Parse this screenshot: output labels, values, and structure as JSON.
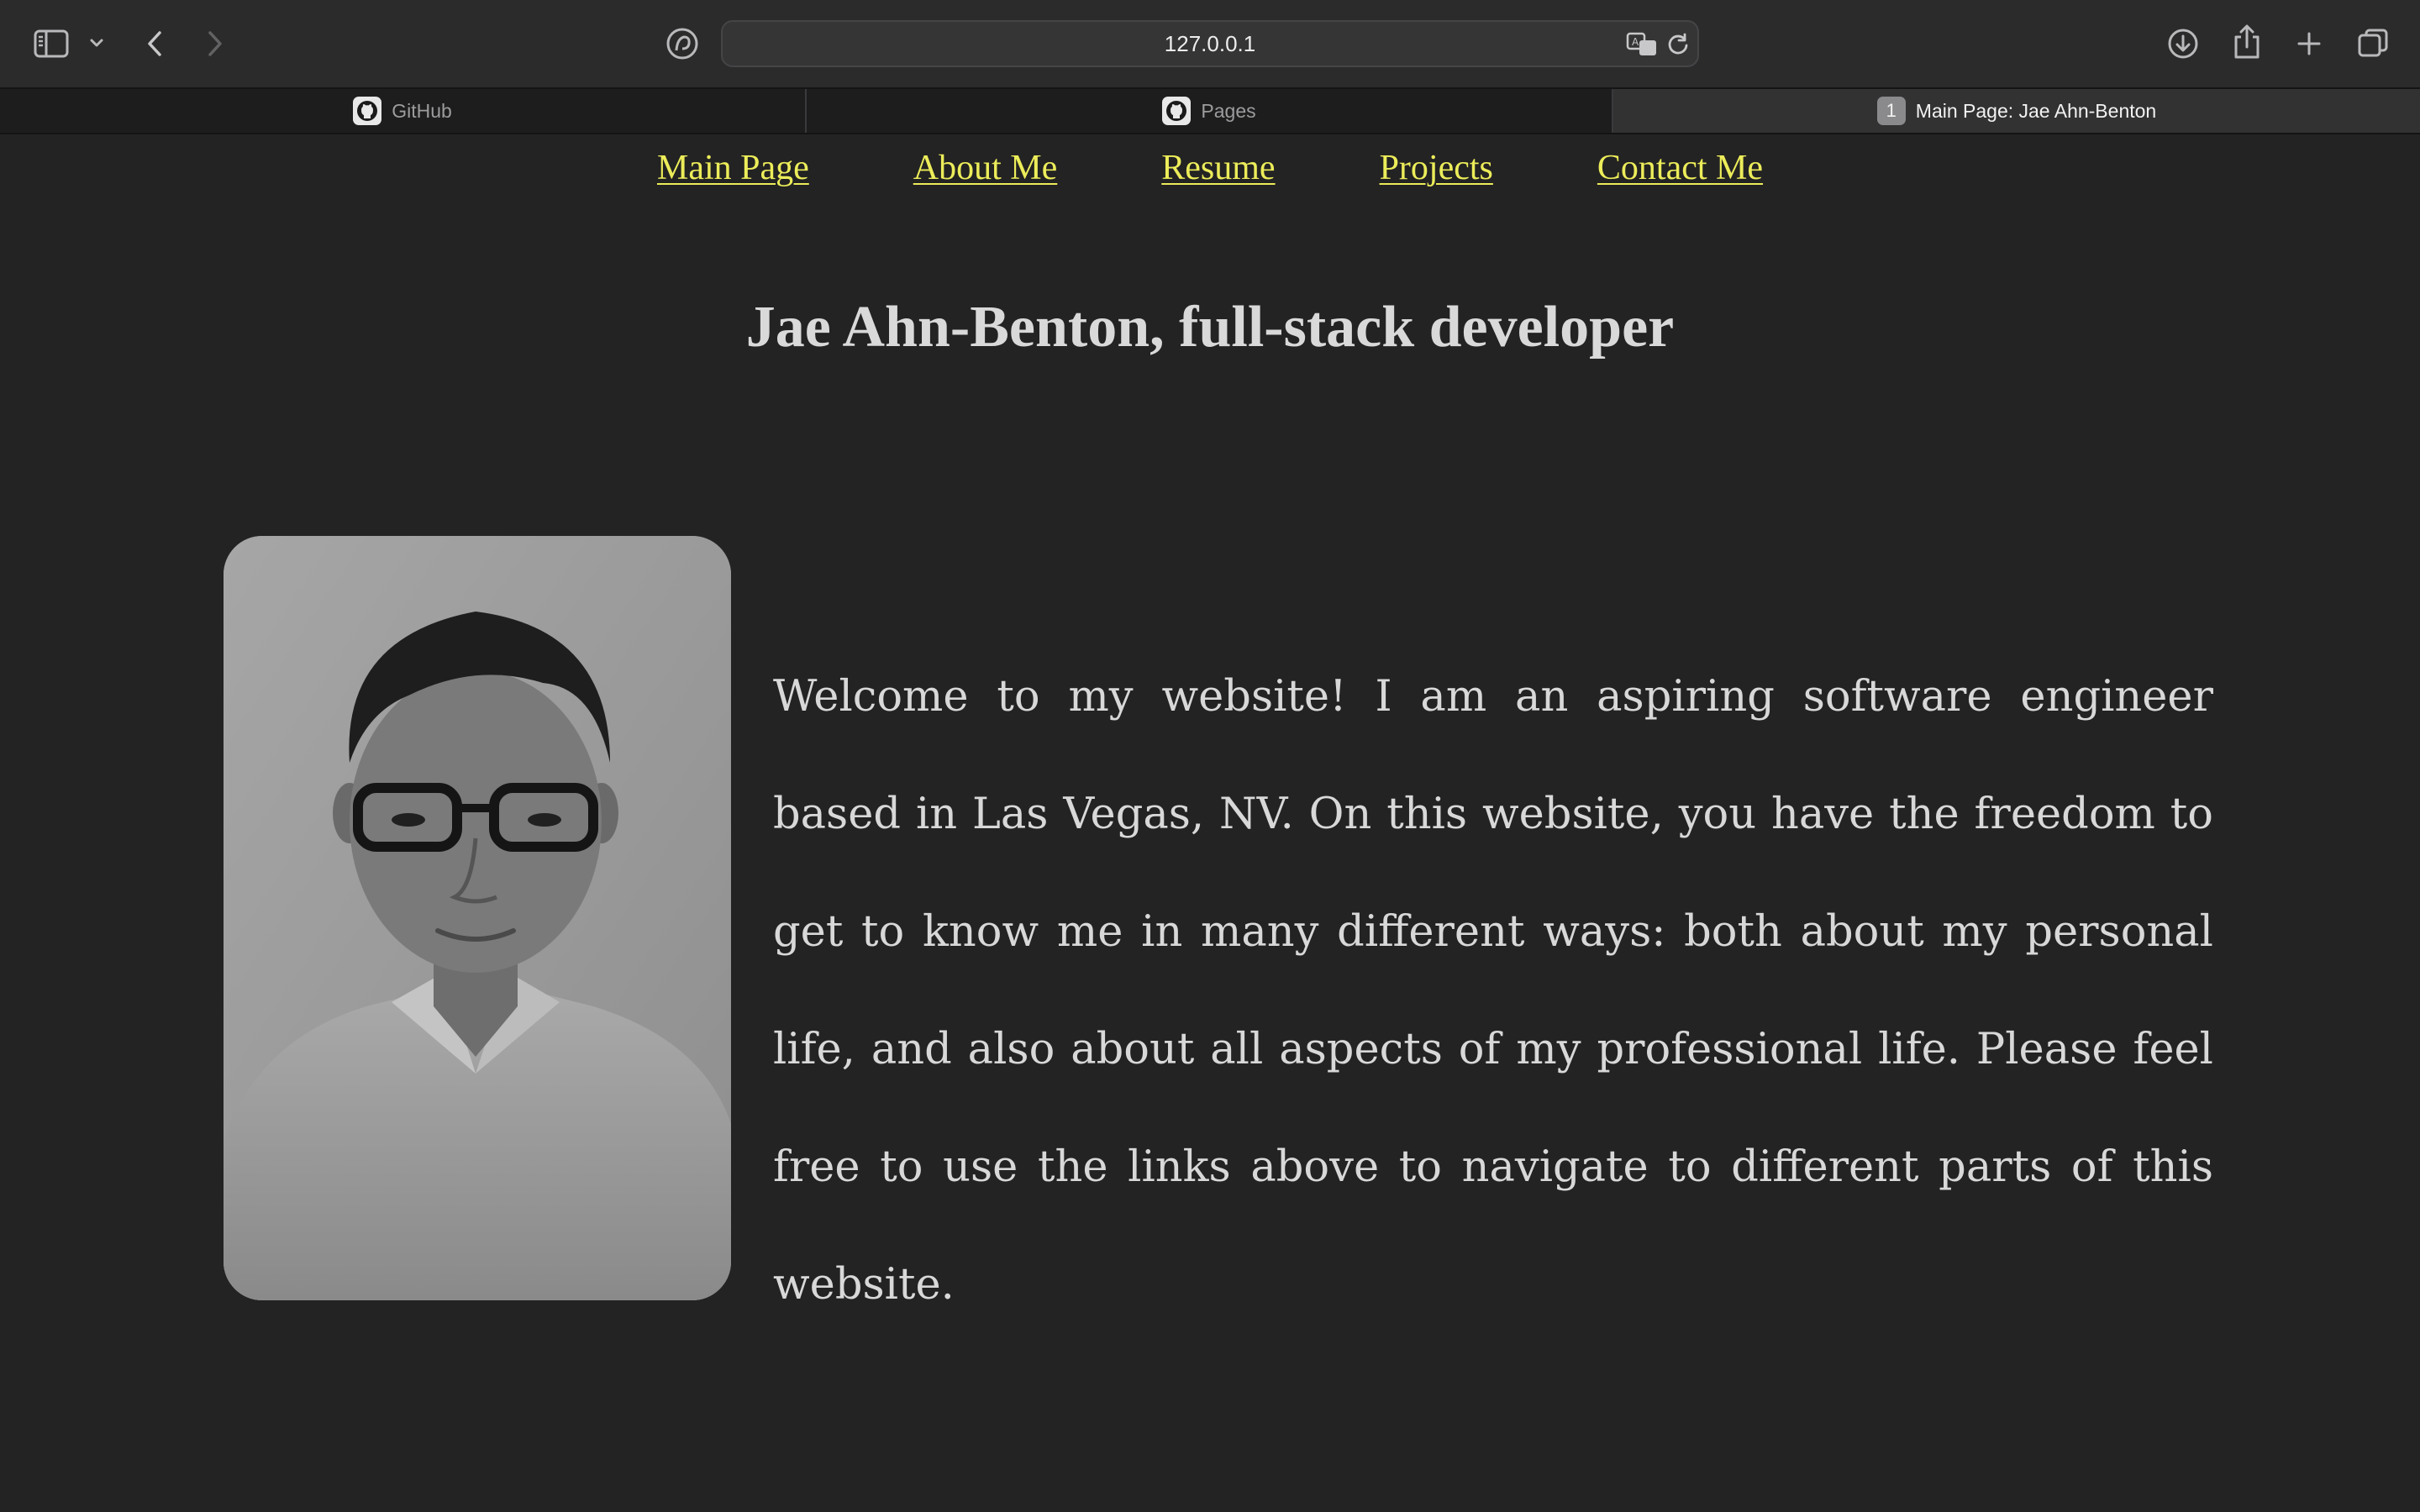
{
  "browser": {
    "address": "127.0.0.1",
    "tabs": [
      {
        "label": "GitHub",
        "icon": "github-icon",
        "active": false
      },
      {
        "label": "Pages",
        "icon": "github-icon",
        "active": false
      },
      {
        "label": "Main Page: Jae Ahn-Benton",
        "badge": "1",
        "active": true
      }
    ],
    "toolbar_icons": [
      "sidebar-icon",
      "chevron-down-icon",
      "back-icon",
      "forward-icon",
      "privacy-icon",
      "translate-icon",
      "reload-icon",
      "download-icon",
      "share-icon",
      "new-tab-icon",
      "tab-overview-icon"
    ]
  },
  "page": {
    "nav": [
      {
        "label": "Main Page"
      },
      {
        "label": "About Me"
      },
      {
        "label": "Resume"
      },
      {
        "label": "Projects"
      },
      {
        "label": "Contact Me"
      }
    ],
    "title": "Jae Ahn-Benton, full-stack developer",
    "intro": "Welcome to my website! I am an aspiring software engineer based in Las Vegas, NV. On this website, you have the freedom to get to know me in many different ways: both about my personal life, and also about all aspects of my professional life. Please feel free to use the links above to navigate to different parts of this website."
  },
  "colors": {
    "page_background": "#232323",
    "nav_link": "#ecec5a",
    "heading_text": "#d9d9d9",
    "body_text": "#d8d8d8",
    "toolbar": "#2b2b2c"
  }
}
